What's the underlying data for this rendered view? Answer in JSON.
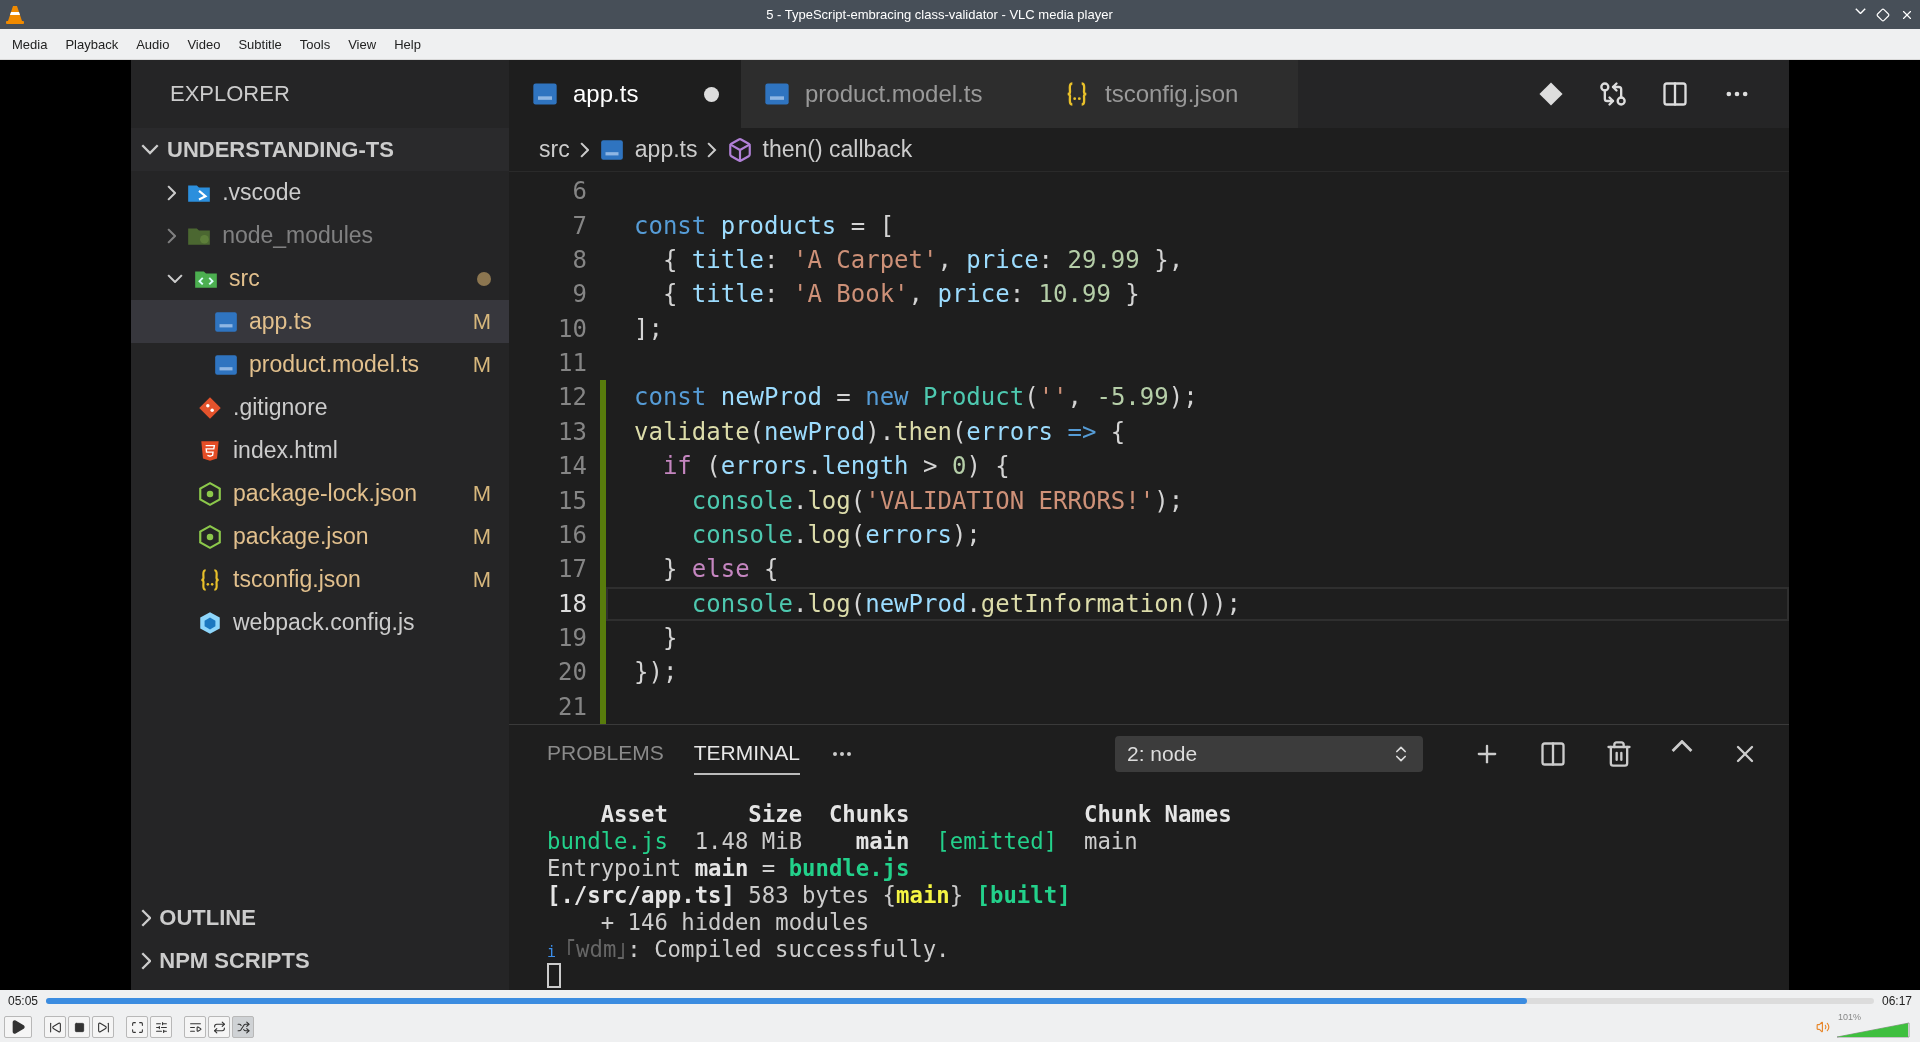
{
  "window": {
    "title": "5 - TypeScript-embracing class-validator - VLC media player"
  },
  "menu": [
    "Media",
    "Playback",
    "Audio",
    "Video",
    "Subtitle",
    "Tools",
    "View",
    "Help"
  ],
  "video": {
    "sidebar": {
      "title": "EXPLORER",
      "root": {
        "label": "UNDERSTANDING-TS",
        "expanded": true
      },
      "items": [
        {
          "label": ".vscode",
          "kind": "folder-vscode",
          "expanded": false,
          "selected": false,
          "modified": false,
          "ignored": false,
          "contains_changes": false
        },
        {
          "label": "node_modules",
          "kind": "folder-node",
          "expanded": false,
          "selected": false,
          "modified": false,
          "ignored": true,
          "contains_changes": false
        },
        {
          "label": "src",
          "kind": "folder-src",
          "expanded": true,
          "selected": false,
          "modified": false,
          "ignored": false,
          "contains_changes": true,
          "children": [
            {
              "label": "app.ts",
              "kind": "ts",
              "selected": true,
              "modified": true,
              "ignored": false,
              "contains_changes": false,
              "badge": "M"
            },
            {
              "label": "product.model.ts",
              "kind": "ts",
              "selected": false,
              "modified": true,
              "ignored": false,
              "contains_changes": false,
              "badge": "M"
            }
          ]
        },
        {
          "label": ".gitignore",
          "kind": "git",
          "selected": false,
          "modified": false,
          "ignored": false,
          "contains_changes": false
        },
        {
          "label": "index.html",
          "kind": "html",
          "selected": false,
          "modified": false,
          "ignored": false,
          "contains_changes": false
        },
        {
          "label": "package-lock.json",
          "kind": "node",
          "selected": false,
          "modified": true,
          "ignored": false,
          "contains_changes": false,
          "badge": "M"
        },
        {
          "label": "package.json",
          "kind": "node",
          "selected": false,
          "modified": true,
          "ignored": false,
          "contains_changes": false,
          "badge": "M"
        },
        {
          "label": "tsconfig.json",
          "kind": "json",
          "selected": false,
          "modified": true,
          "ignored": false,
          "contains_changes": false,
          "badge": "M"
        },
        {
          "label": "webpack.config.js",
          "kind": "webpack",
          "selected": false,
          "modified": false,
          "ignored": false,
          "contains_changes": false
        }
      ],
      "sections": [
        {
          "label": "OUTLINE",
          "expanded": false
        },
        {
          "label": "NPM SCRIPTS",
          "expanded": false
        }
      ]
    },
    "editor": {
      "tabs": [
        {
          "label": "app.ts",
          "kind": "ts",
          "selected": true,
          "dirty": true
        },
        {
          "label": "product.model.ts",
          "kind": "ts",
          "selected": false,
          "dirty": false
        },
        {
          "label": "tsconfig.json",
          "kind": "json",
          "selected": false,
          "dirty": false
        }
      ],
      "breadcrumb": [
        {
          "label": "src"
        },
        {
          "label": "app.ts",
          "kind": "ts"
        },
        {
          "label": "then() callback",
          "kind": "symbol"
        }
      ],
      "lines": [
        {
          "number": "6",
          "changed": false,
          "current": false
        },
        {
          "number": "7",
          "changed": false,
          "current": false,
          "tokens": [
            {
              "t": "const ",
              "kind": "kw"
            },
            {
              "t": "products",
              "kind": "var"
            },
            {
              "t": " = [",
              "kind": "p"
            }
          ]
        },
        {
          "number": "8",
          "changed": false,
          "current": false,
          "tokens": [
            {
              "t": "  { ",
              "kind": "p"
            },
            {
              "t": "title",
              "kind": "var"
            },
            {
              "t": ": ",
              "kind": "p"
            },
            {
              "t": "'A Carpet'",
              "kind": "str"
            },
            {
              "t": ", ",
              "kind": "p"
            },
            {
              "t": "price",
              "kind": "var"
            },
            {
              "t": ": ",
              "kind": "p"
            },
            {
              "t": "29.99",
              "kind": "num"
            },
            {
              "t": " },",
              "kind": "p"
            }
          ]
        },
        {
          "number": "9",
          "changed": false,
          "current": false,
          "tokens": [
            {
              "t": "  { ",
              "kind": "p"
            },
            {
              "t": "title",
              "kind": "var"
            },
            {
              "t": ": ",
              "kind": "p"
            },
            {
              "t": "'A Book'",
              "kind": "str"
            },
            {
              "t": ", ",
              "kind": "p"
            },
            {
              "t": "price",
              "kind": "var"
            },
            {
              "t": ": ",
              "kind": "p"
            },
            {
              "t": "10.99",
              "kind": "num"
            },
            {
              "t": " }",
              "kind": "p"
            }
          ]
        },
        {
          "number": "10",
          "changed": false,
          "current": false,
          "tokens": [
            {
              "t": "];",
              "kind": "p"
            }
          ]
        },
        {
          "number": "11",
          "changed": false,
          "current": false
        },
        {
          "number": "12",
          "changed": true,
          "current": false,
          "tokens": [
            {
              "t": "const ",
              "kind": "kw"
            },
            {
              "t": "newProd",
              "kind": "var"
            },
            {
              "t": " = ",
              "kind": "p"
            },
            {
              "t": "new ",
              "kind": "kw"
            },
            {
              "t": "Product",
              "kind": "cls"
            },
            {
              "t": "(",
              "kind": "p"
            },
            {
              "t": "''",
              "kind": "str"
            },
            {
              "t": ", ",
              "kind": "p"
            },
            {
              "t": "-5.99",
              "kind": "num"
            },
            {
              "t": ");",
              "kind": "p"
            }
          ]
        },
        {
          "number": "13",
          "changed": true,
          "current": false,
          "tokens": [
            {
              "t": "validate",
              "kind": "fn"
            },
            {
              "t": "(",
              "kind": "p"
            },
            {
              "t": "newProd",
              "kind": "var"
            },
            {
              "t": ").",
              "kind": "p"
            },
            {
              "t": "then",
              "kind": "fn"
            },
            {
              "t": "(",
              "kind": "p"
            },
            {
              "t": "errors",
              "kind": "var"
            },
            {
              "t": " =>",
              "kind": "kw"
            },
            {
              "t": " {",
              "kind": "p"
            }
          ]
        },
        {
          "number": "14",
          "changed": true,
          "current": false,
          "tokens": [
            {
              "t": "  if",
              "kind": "ctl"
            },
            {
              "t": " (",
              "kind": "p"
            },
            {
              "t": "errors",
              "kind": "var"
            },
            {
              "t": ".",
              "kind": "p"
            },
            {
              "t": "length",
              "kind": "var"
            },
            {
              "t": " > ",
              "kind": "p"
            },
            {
              "t": "0",
              "kind": "num"
            },
            {
              "t": ") {",
              "kind": "p"
            }
          ]
        },
        {
          "number": "15",
          "changed": true,
          "current": false,
          "tokens": [
            {
              "t": "    console",
              "kind": "cls"
            },
            {
              "t": ".",
              "kind": "p"
            },
            {
              "t": "log",
              "kind": "fn"
            },
            {
              "t": "(",
              "kind": "p"
            },
            {
              "t": "'VALIDATION ERRORS!'",
              "kind": "str"
            },
            {
              "t": ");",
              "kind": "p"
            }
          ]
        },
        {
          "number": "16",
          "changed": true,
          "current": false,
          "tokens": [
            {
              "t": "    console",
              "kind": "cls"
            },
            {
              "t": ".",
              "kind": "p"
            },
            {
              "t": "log",
              "kind": "fn"
            },
            {
              "t": "(",
              "kind": "p"
            },
            {
              "t": "errors",
              "kind": "var"
            },
            {
              "t": ");",
              "kind": "p"
            }
          ]
        },
        {
          "number": "17",
          "changed": true,
          "current": false,
          "tokens": [
            {
              "t": "  } ",
              "kind": "p"
            },
            {
              "t": "else",
              "kind": "ctl"
            },
            {
              "t": " {",
              "kind": "p"
            }
          ]
        },
        {
          "number": "18",
          "changed": true,
          "current": true,
          "tokens": [
            {
              "t": "    console",
              "kind": "cls"
            },
            {
              "t": ".",
              "kind": "p"
            },
            {
              "t": "log",
              "kind": "fn"
            },
            {
              "t": "(",
              "kind": "p"
            },
            {
              "t": "newProd",
              "kind": "var"
            },
            {
              "t": ".",
              "kind": "p"
            },
            {
              "t": "getInformation",
              "kind": "fn"
            },
            {
              "t": "());",
              "kind": "p"
            }
          ]
        },
        {
          "number": "19",
          "changed": true,
          "current": false,
          "tokens": [
            {
              "t": "  }",
              "kind": "p"
            }
          ]
        },
        {
          "number": "20",
          "changed": true,
          "current": false,
          "tokens": [
            {
              "t": "});",
              "kind": "p"
            }
          ]
        },
        {
          "number": "21",
          "changed": true,
          "current": false
        }
      ]
    },
    "panel": {
      "tabs": [
        {
          "label": "PROBLEMS",
          "selected": false
        },
        {
          "label": "TERMINAL",
          "selected": true
        }
      ],
      "terminal_select": "2: node",
      "lines": [
        [
          {
            "t": "    Asset      Size  Chunks             Chunk Names",
            "kind": "bold"
          }
        ],
        [
          {
            "t": "bundle.js",
            "kind": "green"
          },
          {
            "t": "  1.48 MiB    ",
            "kind": "p"
          },
          {
            "t": "main",
            "kind": "bold"
          },
          {
            "t": "  [emitted]",
            "kind": "green"
          },
          {
            "t": "  main",
            "kind": "p"
          }
        ],
        [
          {
            "t": "Entrypoint ",
            "kind": "p"
          },
          {
            "t": "main",
            "kind": "bold"
          },
          {
            "t": " = ",
            "kind": "p"
          },
          {
            "t": "bundle.js",
            "kind": "greenbold"
          }
        ],
        [
          {
            "t": "[./src/app.ts]",
            "kind": "bold"
          },
          {
            "t": " 583 bytes {",
            "kind": "p"
          },
          {
            "t": "main",
            "kind": "yellowbold"
          },
          {
            "t": "} ",
            "kind": "p"
          },
          {
            "t": "[built]",
            "kind": "greenbold"
          }
        ],
        [
          {
            "t": "    + 146 hidden modules",
            "kind": "p"
          }
        ],
        [
          {
            "t": "i ",
            "kind": "info"
          },
          {
            "t": "｢wdm｣",
            "kind": "dim"
          },
          {
            "t": ": Compiled successfully.",
            "kind": "p"
          }
        ]
      ]
    }
  },
  "player": {
    "elapsed": "05:05",
    "total": "06:17",
    "level": 0.81,
    "shuffle": true,
    "volume": {
      "reading": "101%",
      "level": 1
    }
  }
}
